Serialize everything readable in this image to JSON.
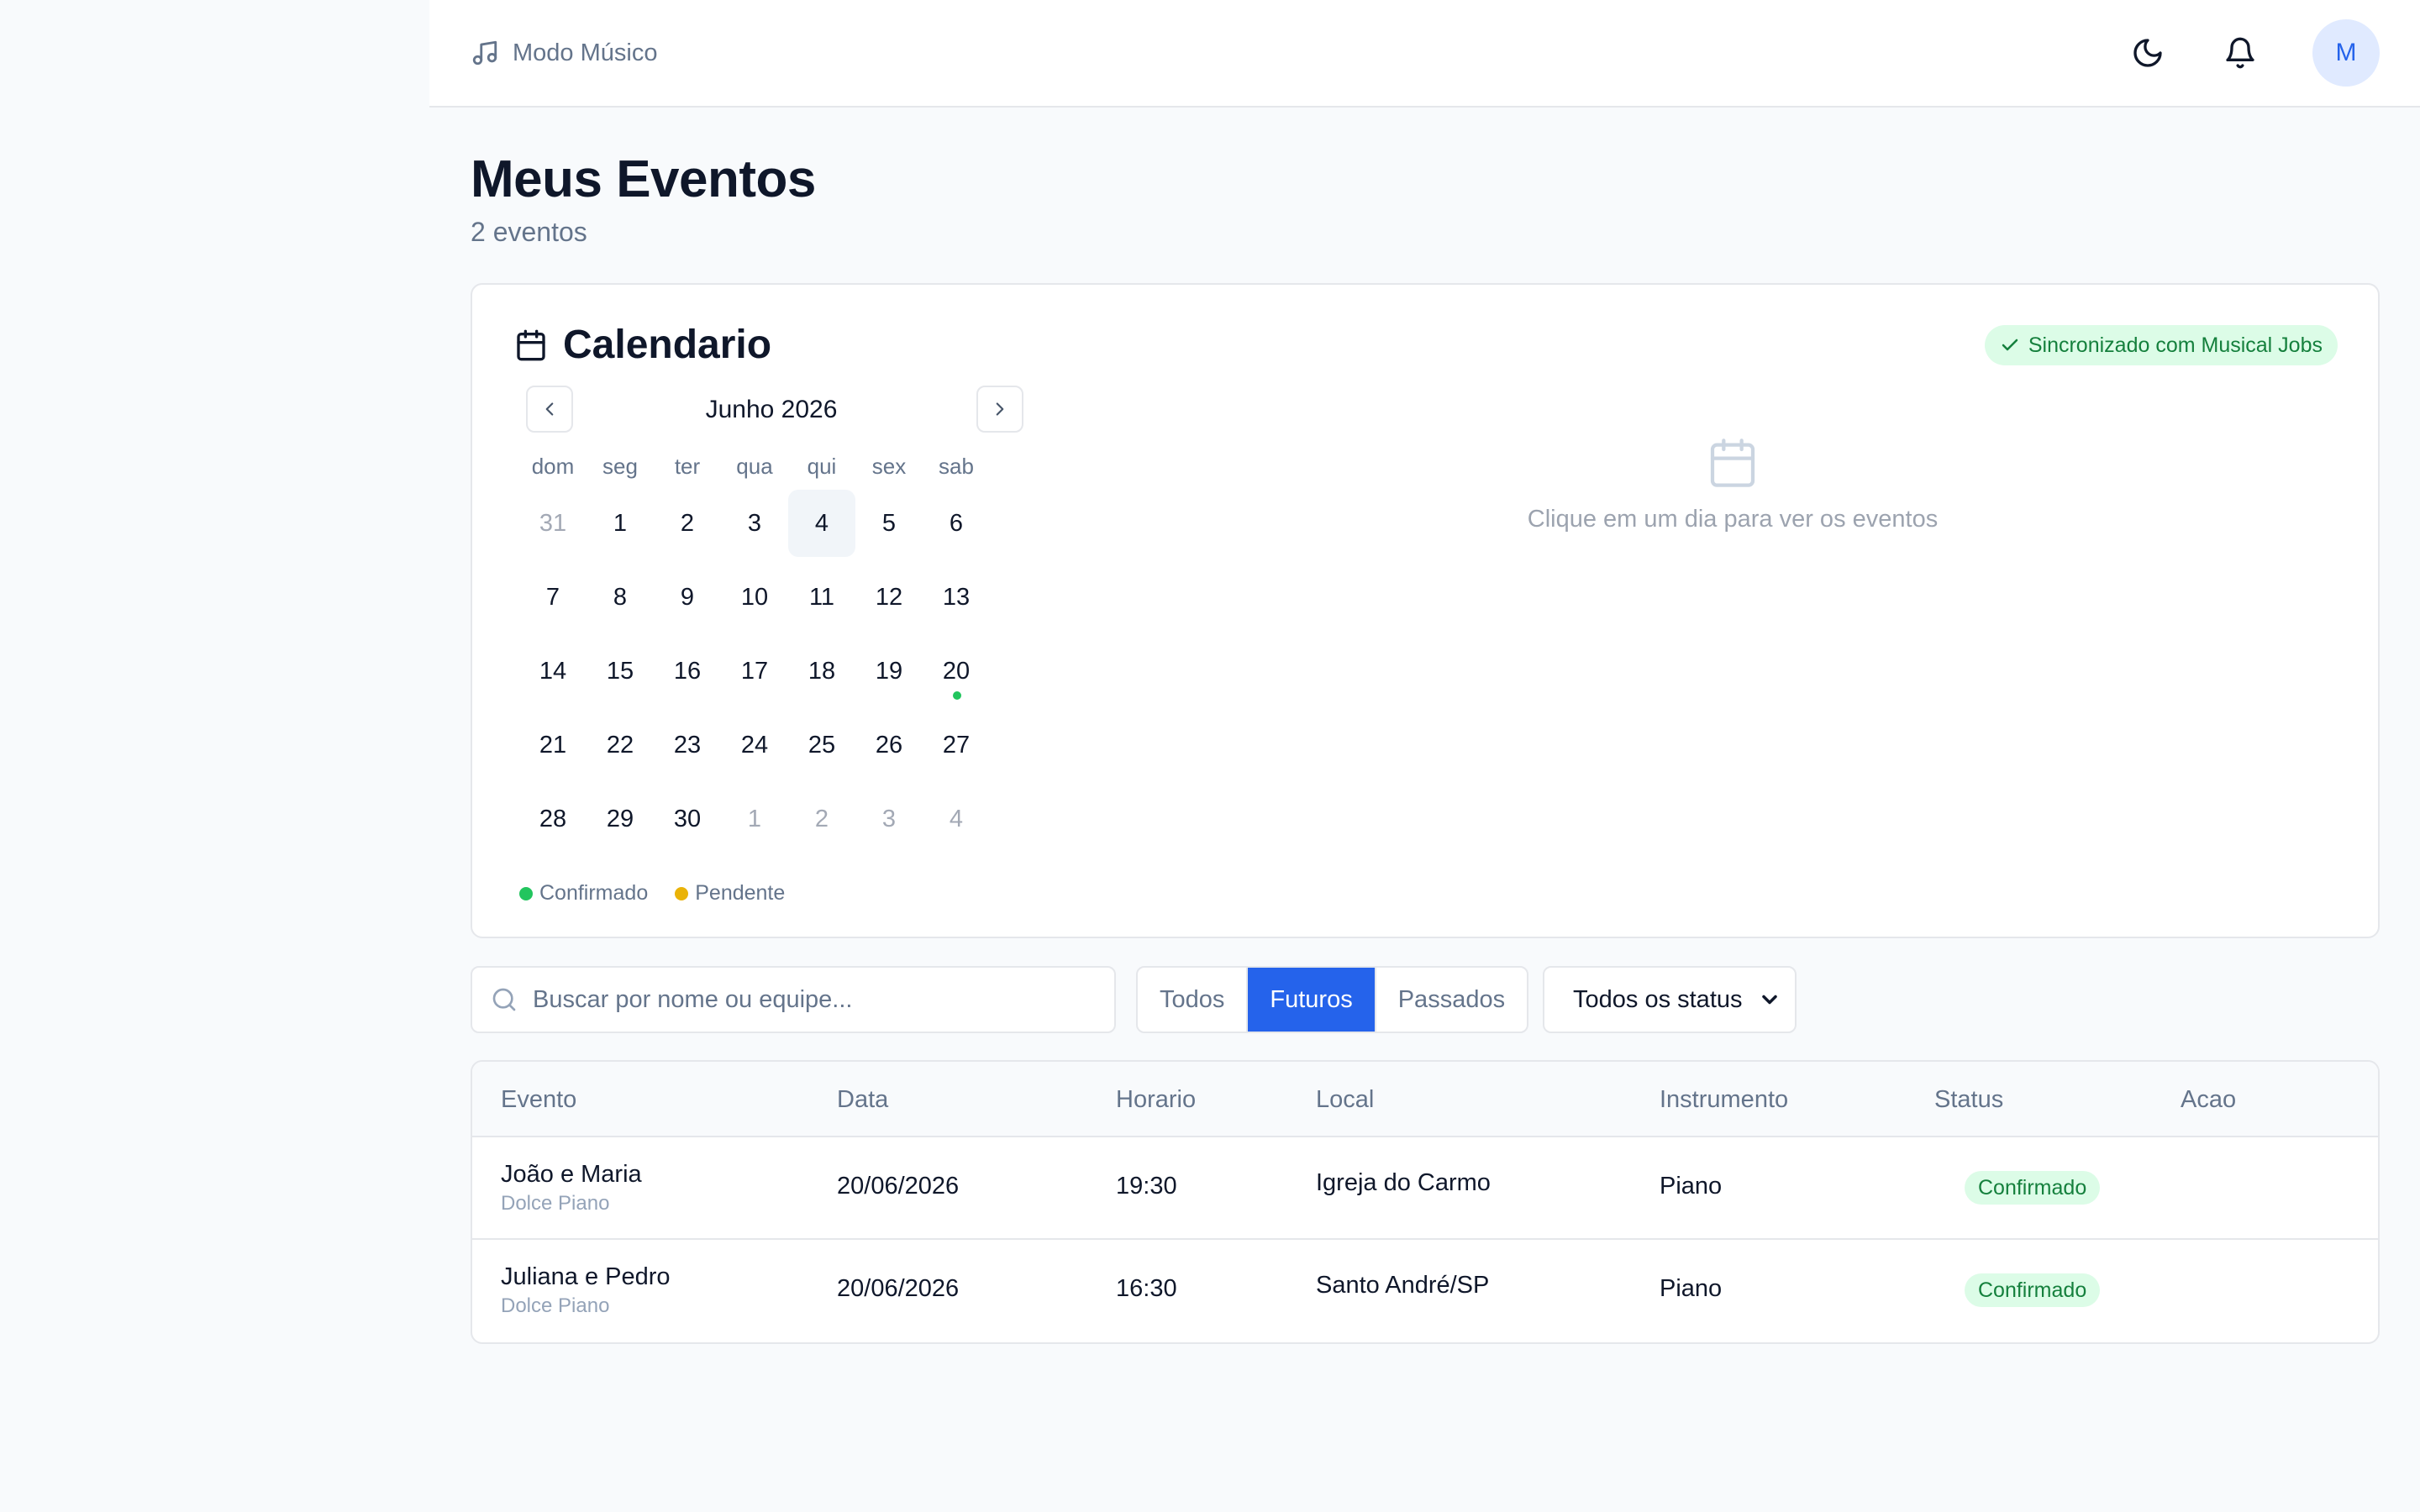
{
  "header": {
    "mode_label": "Modo Músico",
    "avatar_initial": "M"
  },
  "page": {
    "title": "Meus Eventos",
    "subtitle": "2 eventos"
  },
  "calendar": {
    "title": "Calendario",
    "sync_badge": "Sincronizado com Musical Jobs",
    "month_label": "Junho 2026",
    "weekdays": [
      "dom",
      "seg",
      "ter",
      "qua",
      "qui",
      "sex",
      "sab"
    ],
    "days": [
      {
        "n": "31",
        "muted": true
      },
      {
        "n": "1"
      },
      {
        "n": "2"
      },
      {
        "n": "3"
      },
      {
        "n": "4",
        "today": true
      },
      {
        "n": "5"
      },
      {
        "n": "6"
      },
      {
        "n": "7"
      },
      {
        "n": "8"
      },
      {
        "n": "9"
      },
      {
        "n": "10"
      },
      {
        "n": "11"
      },
      {
        "n": "12"
      },
      {
        "n": "13"
      },
      {
        "n": "14"
      },
      {
        "n": "15"
      },
      {
        "n": "16"
      },
      {
        "n": "17"
      },
      {
        "n": "18"
      },
      {
        "n": "19"
      },
      {
        "n": "20",
        "event": "confirmed"
      },
      {
        "n": "21"
      },
      {
        "n": "22"
      },
      {
        "n": "23"
      },
      {
        "n": "24"
      },
      {
        "n": "25"
      },
      {
        "n": "26"
      },
      {
        "n": "27"
      },
      {
        "n": "28"
      },
      {
        "n": "29"
      },
      {
        "n": "30"
      },
      {
        "n": "1",
        "muted": true
      },
      {
        "n": "2",
        "muted": true
      },
      {
        "n": "3",
        "muted": true
      },
      {
        "n": "4",
        "muted": true
      }
    ],
    "legend": [
      {
        "label": "Confirmado",
        "color": "#22c55e"
      },
      {
        "label": "Pendente",
        "color": "#eab308"
      }
    ],
    "empty_text": "Clique em um dia para ver os eventos"
  },
  "filters": {
    "search_placeholder": "Buscar por nome ou equipe...",
    "segments": [
      {
        "label": "Todos",
        "active": false
      },
      {
        "label": "Futuros",
        "active": true
      },
      {
        "label": "Passados",
        "active": false
      }
    ],
    "status_selected": "Todos os status"
  },
  "table": {
    "columns": [
      "Evento",
      "Data",
      "Horario",
      "Local",
      "Instrumento",
      "Status",
      "Acao"
    ],
    "rows": [
      {
        "event": "João e Maria",
        "team": "Dolce Piano",
        "date": "20/06/2026",
        "time": "19:30",
        "place": "Igreja do Carmo",
        "instrument": "Piano",
        "status": "Confirmado"
      },
      {
        "event": "Juliana e Pedro",
        "team": "Dolce Piano",
        "date": "20/06/2026",
        "time": "16:30",
        "place": "Santo André/SP",
        "instrument": "Piano",
        "status": "Confirmado"
      }
    ]
  },
  "colors": {
    "accent": "#2563eb",
    "confirmed": "#22c55e",
    "pending": "#eab308"
  }
}
